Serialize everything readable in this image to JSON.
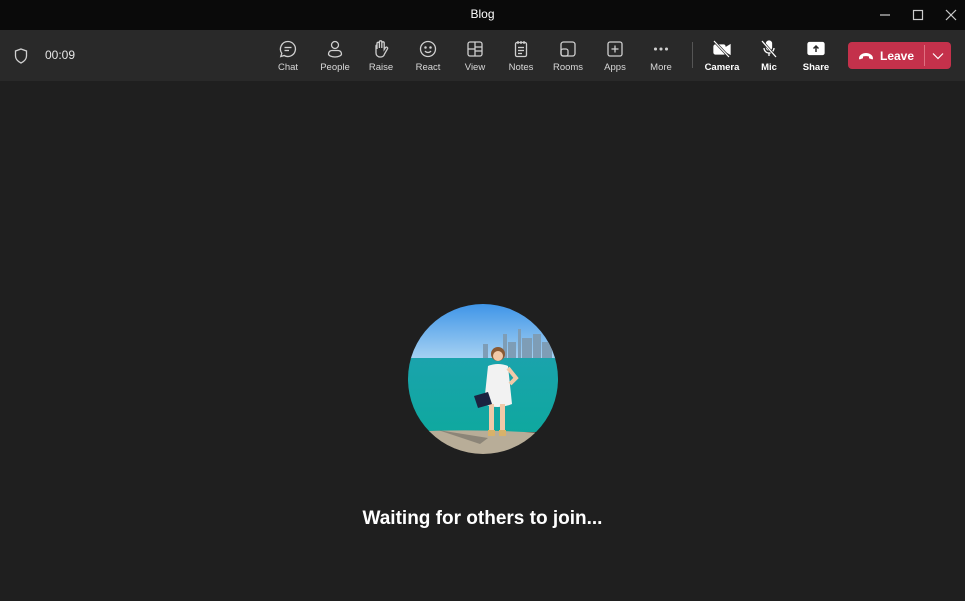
{
  "window": {
    "title": "Blog",
    "controls": {
      "minimize": "minimize-icon",
      "maximize": "maximize-icon",
      "close": "close-icon"
    }
  },
  "toolbar": {
    "timer": "00:09",
    "items": [
      {
        "label": "Chat",
        "icon": "chat-icon"
      },
      {
        "label": "People",
        "icon": "people-icon"
      },
      {
        "label": "Raise",
        "icon": "raise-hand-icon"
      },
      {
        "label": "React",
        "icon": "react-icon"
      },
      {
        "label": "View",
        "icon": "view-icon"
      },
      {
        "label": "Notes",
        "icon": "notes-icon"
      },
      {
        "label": "Rooms",
        "icon": "rooms-icon"
      },
      {
        "label": "Apps",
        "icon": "apps-icon"
      },
      {
        "label": "More",
        "icon": "more-icon"
      }
    ],
    "media": [
      {
        "label": "Camera",
        "icon": "camera-off-icon"
      },
      {
        "label": "Mic",
        "icon": "mic-off-icon"
      },
      {
        "label": "Share",
        "icon": "share-icon"
      }
    ],
    "leave_label": "Leave",
    "leave_color": "#c4314b"
  },
  "stage": {
    "status_text": "Waiting for others to join..."
  }
}
